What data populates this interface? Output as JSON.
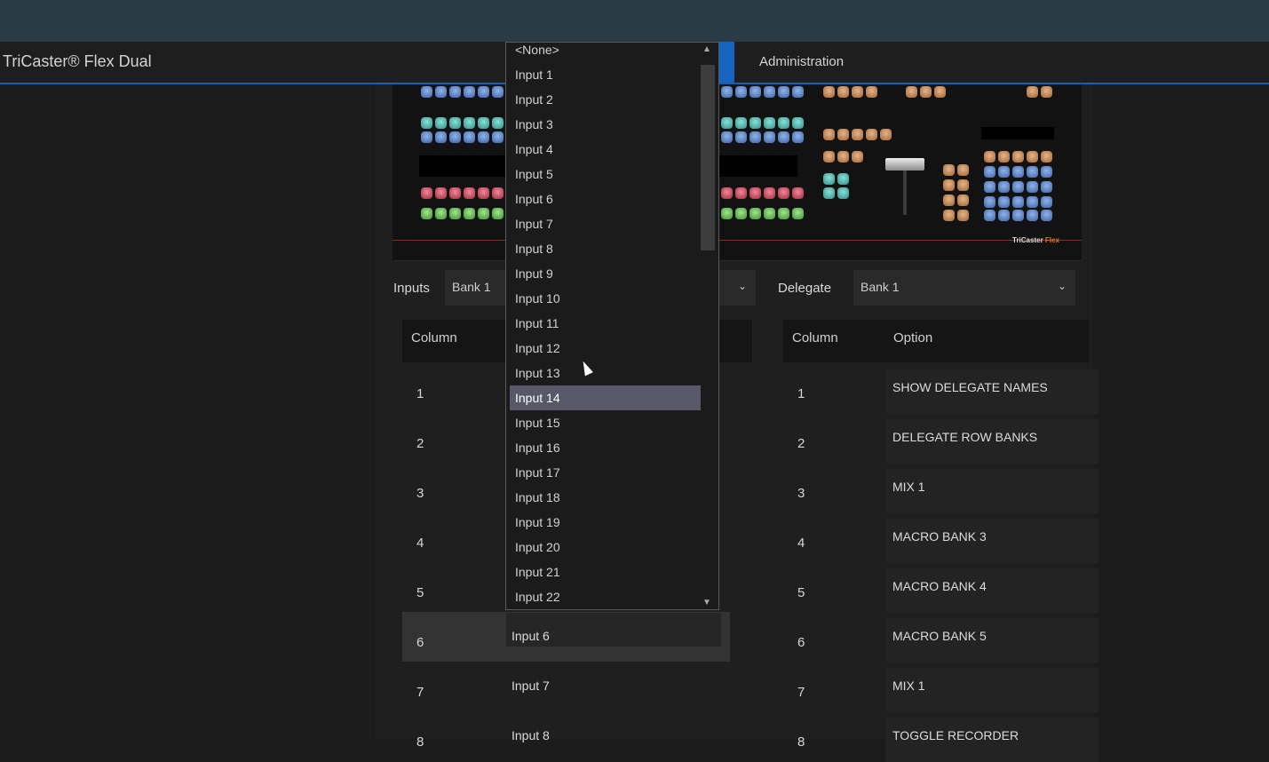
{
  "app": {
    "title": "TriCaster® Flex Dual",
    "admin_tab": "Administration"
  },
  "console_image": {
    "brand": "TriCaster",
    "brand_suffix": "Flex",
    "icon": "control-surface-image"
  },
  "inputs_selector": {
    "label": "Inputs",
    "value": "Bank 1"
  },
  "delegate_selector": {
    "label": "Delegate",
    "value": "Bank 1"
  },
  "left_table": {
    "header_column": "Column",
    "rows": [
      {
        "num": "1",
        "value": ""
      },
      {
        "num": "2",
        "value": ""
      },
      {
        "num": "3",
        "value": ""
      },
      {
        "num": "4",
        "value": ""
      },
      {
        "num": "5",
        "value": ""
      },
      {
        "num": "6",
        "value": "Input 6"
      },
      {
        "num": "7",
        "value": "Input 7"
      },
      {
        "num": "8",
        "value": "Input 8"
      }
    ]
  },
  "right_table": {
    "header_column": "Column",
    "header_option": "Option",
    "rows": [
      {
        "num": "1",
        "option": "SHOW DELEGATE NAMES"
      },
      {
        "num": "2",
        "option": "DELEGATE ROW BANKS"
      },
      {
        "num": "3",
        "option": "MIX 1"
      },
      {
        "num": "4",
        "option": "MACRO BANK 3"
      },
      {
        "num": "5",
        "option": "MACRO BANK 4"
      },
      {
        "num": "6",
        "option": "MACRO BANK 5"
      },
      {
        "num": "7",
        "option": "MIX 1"
      },
      {
        "num": "8",
        "option": "TOGGLE RECORDER"
      }
    ]
  },
  "dropdown": {
    "items": [
      "<None>",
      "Input 1",
      "Input 2",
      "Input 3",
      "Input 4",
      "Input 5",
      "Input 6",
      "Input 7",
      "Input 8",
      "Input 9",
      "Input 10",
      "Input 11",
      "Input 12",
      "Input 13",
      "Input 14",
      "Input 15",
      "Input 16",
      "Input 17",
      "Input 18",
      "Input 19",
      "Input 20",
      "Input 21",
      "Input 22"
    ],
    "selected": "Input 14"
  },
  "colors": {
    "accent": "#1565c0",
    "top_strip": "#2b3b46",
    "selected_item": "#585868"
  }
}
